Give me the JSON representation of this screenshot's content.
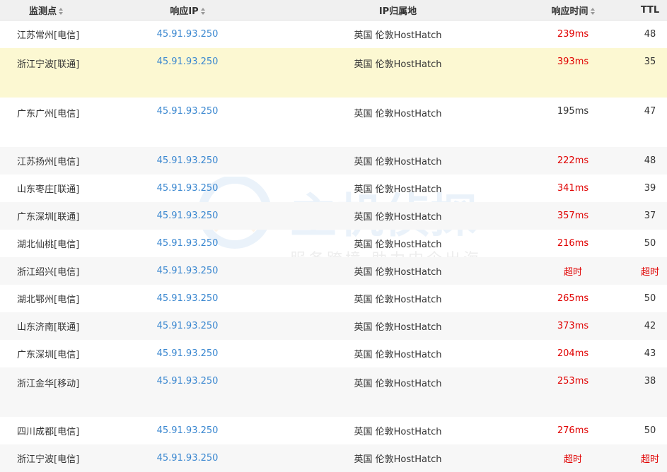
{
  "headers": {
    "node": "监测点",
    "ip": "响应IP",
    "location": "IP归属地",
    "time": "响应时间",
    "ttl": "TTL"
  },
  "watermark": {
    "title": "主机侦探",
    "slogan": "服务跨境 助力中企出海"
  },
  "colors": {
    "ip": "#3a87d0",
    "slow": "#e00000",
    "highlight": "#fcf8d2",
    "header_bg": "#f0f0f0"
  },
  "rows": [
    {
      "node": "江苏常州[电信]",
      "ip": "45.91.93.250",
      "location": "英国 伦敦HostHatch",
      "time": "239ms",
      "ttl": "48"
    },
    {
      "node": "浙江宁波[联通]",
      "ip": "45.91.93.250",
      "location": "英国 伦敦HostHatch",
      "time": "393ms",
      "ttl": "35"
    },
    {
      "node": "广东广州[电信]",
      "ip": "45.91.93.250",
      "location": "英国 伦敦HostHatch",
      "time": "195ms",
      "ttl": "47"
    },
    {
      "node": "江苏扬州[电信]",
      "ip": "45.91.93.250",
      "location": "英国 伦敦HostHatch",
      "time": "222ms",
      "ttl": "48"
    },
    {
      "node": "山东枣庄[联通]",
      "ip": "45.91.93.250",
      "location": "英国 伦敦HostHatch",
      "time": "341ms",
      "ttl": "39"
    },
    {
      "node": "广东深圳[联通]",
      "ip": "45.91.93.250",
      "location": "英国 伦敦HostHatch",
      "time": "357ms",
      "ttl": "37"
    },
    {
      "node": "湖北仙桃[电信]",
      "ip": "45.91.93.250",
      "location": "英国 伦敦HostHatch",
      "time": "216ms",
      "ttl": "50"
    },
    {
      "node": "浙江绍兴[电信]",
      "ip": "45.91.93.250",
      "location": "英国 伦敦HostHatch",
      "time": "超时",
      "ttl": "超时"
    },
    {
      "node": "湖北鄂州[电信]",
      "ip": "45.91.93.250",
      "location": "英国 伦敦HostHatch",
      "time": "265ms",
      "ttl": "50"
    },
    {
      "node": "山东济南[联通]",
      "ip": "45.91.93.250",
      "location": "英国 伦敦HostHatch",
      "time": "373ms",
      "ttl": "42"
    },
    {
      "node": "广东深圳[电信]",
      "ip": "45.91.93.250",
      "location": "英国 伦敦HostHatch",
      "time": "204ms",
      "ttl": "43"
    },
    {
      "node": "浙江金华[移动]",
      "ip": "45.91.93.250",
      "location": "英国 伦敦HostHatch",
      "time": "253ms",
      "ttl": "38"
    },
    {
      "node": "四川成都[电信]",
      "ip": "45.91.93.250",
      "location": "英国 伦敦HostHatch",
      "time": "276ms",
      "ttl": "50"
    },
    {
      "node": "浙江宁波[电信]",
      "ip": "45.91.93.250",
      "location": "英国 伦敦HostHatch",
      "time": "超时",
      "ttl": "超时"
    }
  ]
}
